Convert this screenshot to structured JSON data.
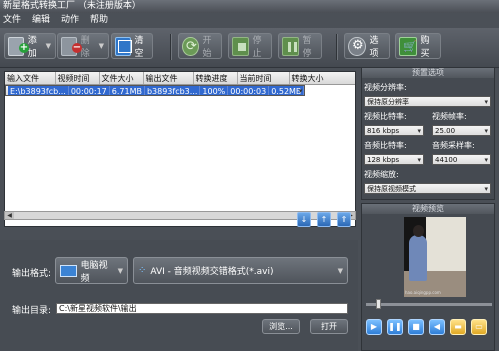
{
  "window": {
    "title": "新星格式转换工厂 （未注册版本）"
  },
  "menu": [
    "文件",
    "编辑",
    "动作",
    "帮助"
  ],
  "toolbar": {
    "add": "添加",
    "delete": "删除",
    "clear": "清空",
    "start": "开始",
    "stop": "停止",
    "pause": "暂停",
    "options": "选项",
    "buy": "购买"
  },
  "table": {
    "columns": [
      "输入文件",
      "视频时间",
      "文件大小",
      "输出文件",
      "转换进度",
      "当前时间",
      "转换大小"
    ],
    "rows": [
      [
        "E:\\b3893fcb...",
        "00:00:17",
        "6.71MB",
        "b3893fcb3...",
        "100%",
        "00:00:03",
        "0.52MB"
      ]
    ]
  },
  "output": {
    "format_label": "输出格式:",
    "device_button": "电脑视频",
    "format_value": "AVI - 音频视频交错格式(*.avi)",
    "dir_label": "输出目录:",
    "dir_value": "C:\\新星视频软件\\输出",
    "browse": "浏览...",
    "open": "打开"
  },
  "preset": {
    "title": "预置选项",
    "resolution_label": "视频分辨率:",
    "resolution_value": "保持原分辨率",
    "vbitrate_label": "视频比特率:",
    "vbitrate_value": "816 kbps",
    "framerate_label": "视频帧率:",
    "framerate_value": "25.00",
    "abitrate_label": "音频比特率:",
    "abitrate_value": "128 kbps",
    "samplerate_label": "音频采样率:",
    "samplerate_value": "44100",
    "scale_label": "视频缩放:",
    "scale_value": "保持原视频模式"
  },
  "preview": {
    "title": "视频预览",
    "watermark": "hao.aiqingpp.com"
  }
}
